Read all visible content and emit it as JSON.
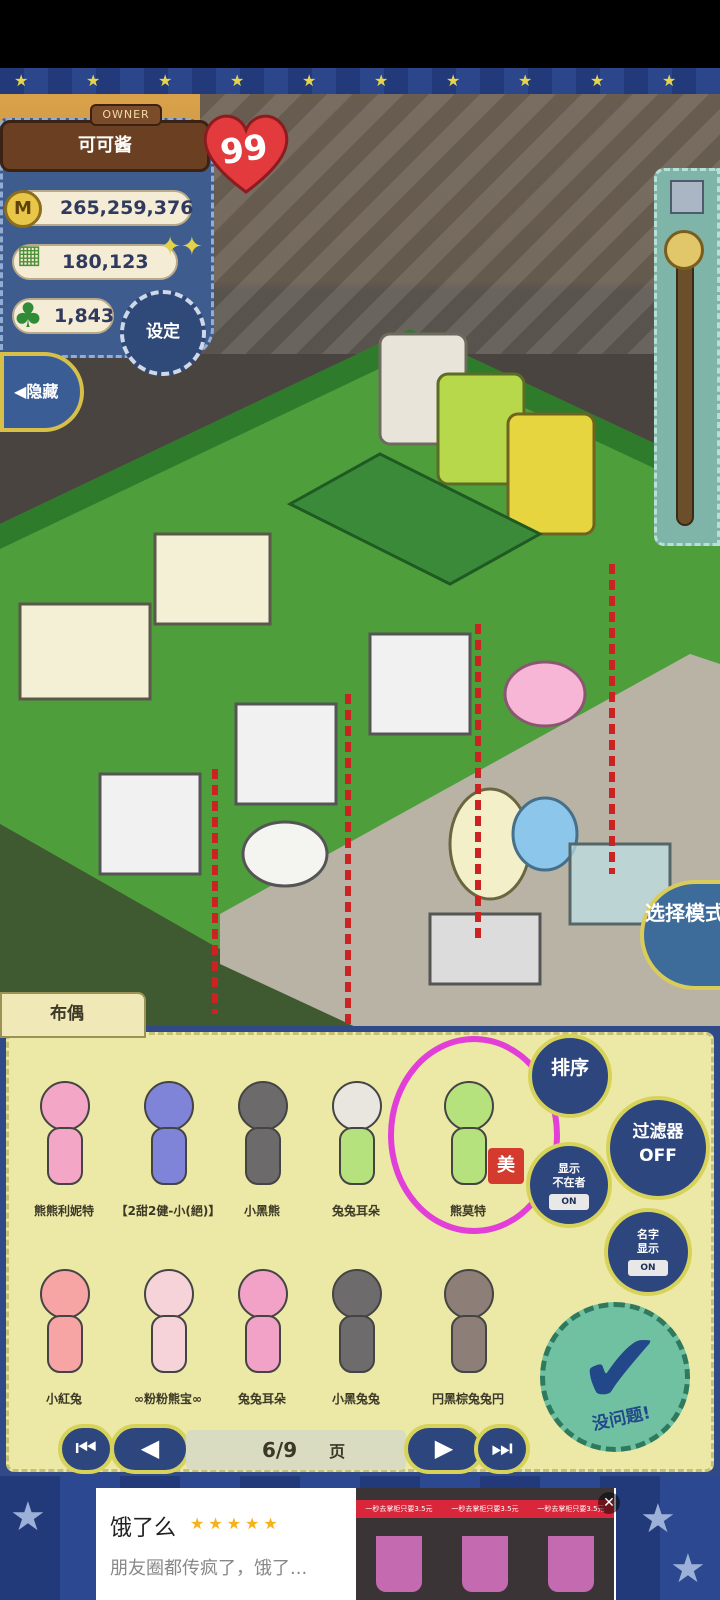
{
  "hud": {
    "owner_tag": "OWNER",
    "owner_name": "可可酱",
    "hearts": "99",
    "money": "265,259,376",
    "crates": "180,123",
    "clovers": "1,843",
    "settings_label": "设定",
    "hide_label": "隐藏",
    "coin_glyph": "M"
  },
  "mode_button": "选择模式",
  "category_tab": "布偶",
  "items": [
    {
      "name": "熊熊利妮特",
      "color": "#f4a6c6"
    },
    {
      "name": "【2甜2健-小(絕)】",
      "color": "#7f84d8"
    },
    {
      "name": "小黑熊",
      "color": "#6d6a6c"
    },
    {
      "name": "兔兔耳朵",
      "color": "#e9e6e0"
    },
    {
      "name": "熊莫特",
      "color": "#b6e27e"
    },
    {
      "name": "小紅兔",
      "color": "#f7a4a4"
    },
    {
      "name": "∞粉粉熊宝∞",
      "color": "#f6d3d9"
    },
    {
      "name": "兔兔耳朵",
      "color": "#f2a2c6"
    },
    {
      "name": "小黑兔兔",
      "color": "#6e6b6d"
    },
    {
      "name": "円黑棕兔兔円",
      "color": "#8d7f78"
    }
  ],
  "side_buttons": {
    "sort": "排序",
    "filter_line1": "过滤器",
    "filter_line2": "OFF",
    "show_line1": "显示",
    "show_line2": "不在者",
    "show_toggle": "ON",
    "name_line1": "名字",
    "name_line2": "显示",
    "name_toggle": "ON",
    "ok_label": "没问题!"
  },
  "selected_badge": "美",
  "pager": {
    "page": "6/9",
    "suffix": "页"
  },
  "ad": {
    "title": "饿了么",
    "stars": "★★★★★",
    "description": "朋友圈都传疯了，饿了...",
    "banner": "一秒去掌柜只要3.5元"
  }
}
